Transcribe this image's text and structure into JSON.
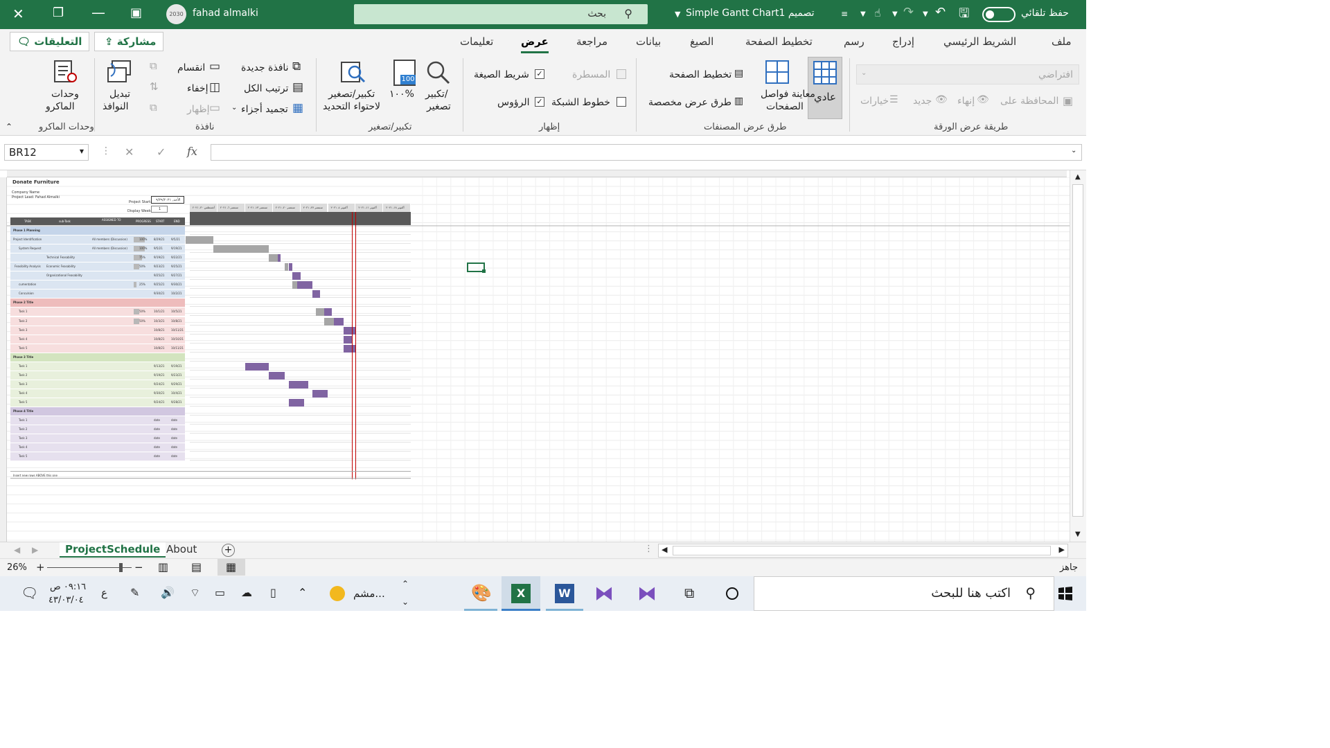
{
  "titlebar": {
    "user_name": "fahad almalki",
    "avatar_text": "2030",
    "search_placeholder": "بحث",
    "file_title": "Simple Gantt Chart1 تصميم",
    "autosave_label": "حفظ تلقائي",
    "autosave_state": "off"
  },
  "menu": {
    "items": [
      "ملف",
      "الشريط الرئيسي",
      "إدراج",
      "رسم",
      "تخطيط الصفحة",
      "الصيغ",
      "بيانات",
      "مراجعة",
      "عرض",
      "تعليمات"
    ],
    "active": "عرض",
    "share_label": "مشاركة",
    "comments_label": "التعليقات"
  },
  "ribbon": {
    "sheet_view": {
      "dropdown": "افتراضي",
      "keep": "المحافظة على",
      "exit": "إنهاء",
      "new": "جديد",
      "options": "خيارات",
      "group": "طريقة عرض الورقة"
    },
    "workbook_views": {
      "normal": "عادي",
      "page_break_1": "معاينة فواصل",
      "page_break_2": "الصفحات",
      "page_layout": "تخطيط الصفحة",
      "custom": "طرق عرض مخصصة",
      "group": "طرق عرض المصنفات"
    },
    "show": {
      "ruler": "المسطرة",
      "formula_bar": "شريط الصيغة",
      "gridlines": "خطوط الشبكة",
      "headings": "الرؤوس",
      "group": "إظهار",
      "ruler_checked": false,
      "formula_bar_checked": true,
      "gridlines_checked": false,
      "headings_checked": true
    },
    "zoom": {
      "zoom_1": "تكبير/",
      "zoom_2": "تصغير",
      "hundred": "١٠٠%",
      "hundred_icon": "100",
      "to_sel_1": "تكبير/تصغير",
      "to_sel_2": "لاحتواء التحديد",
      "group": "تكبير/تصغير"
    },
    "window": {
      "new_window": "نافذة جديدة",
      "arrange": "ترتيب الكل",
      "freeze": "تجميد أجزاء",
      "split": "انقسام",
      "hide": "إخفاء",
      "unhide": "إظهار",
      "switch_1": "تبديل",
      "switch_2": "النوافذ",
      "group": "نافذة"
    },
    "macros": {
      "label_1": "وحدات",
      "label_2": "الماكرو",
      "group": "وحدات الماكرو"
    }
  },
  "formula_bar": {
    "name_box": "BR12",
    "fx": "fx",
    "value": ""
  },
  "sheet": {
    "title": "Donate Furniture",
    "company": "Company Name",
    "lead": "Project Lead: Fahad Almalki",
    "project_start_label": "Project Start:",
    "project_start_value": "الأحد, ٩/٢٩/٢٠٢١",
    "display_week_label": "Display Week:",
    "display_week_value": "1",
    "week_headers": [
      "أغسطس ٣٠، ٢٠٢١",
      "سبتمبر ٦، ٢٠٢١",
      "سبتمبر ١٣، ٢٠٢١",
      "سبتمبر ٢٠، ٢٠٢١",
      "سبتمبر ٢٧، ٢٠٢١",
      "أكتوبر ٤، ٢٠٢١",
      "أكتوبر ١١، ٢٠٢١",
      "أكتوبر ١٨، ٢٠٢١"
    ],
    "col_headers": [
      "TASK",
      "sub-Task",
      "ASSIGNED TO",
      "PROGRESS",
      "START",
      "END"
    ],
    "footer": "Insert new rows ABOVE this one",
    "rows": [
      {
        "task": "Phase 1 Planning",
        "sub": "",
        "assigned": "",
        "progress": "",
        "start": "",
        "end": "",
        "phase": 1,
        "header": true
      },
      {
        "task": "Project Identification",
        "sub": "",
        "assigned": "All members (Discussion)",
        "progress": "100%",
        "start": "8/29/21",
        "end": "9/5/21",
        "phase": 1
      },
      {
        "task": "System Request",
        "sub": "",
        "assigned": "All members (Discussion)",
        "progress": "100%",
        "start": "9/5/21",
        "end": "9/19/21",
        "phase": 1
      },
      {
        "task": "",
        "sub": "Technical Feasability",
        "assigned": "",
        "progress": "75%",
        "start": "9/19/21",
        "end": "9/22/21",
        "phase": 1
      },
      {
        "task": "Feasibility Analysis",
        "sub": "Economic Feasability",
        "assigned": "",
        "progress": "50%",
        "start": "9/23/21",
        "end": "9/25/21",
        "phase": 1
      },
      {
        "task": "",
        "sub": "Organizational Feasability",
        "assigned": "",
        "progress": "",
        "start": "9/25/21",
        "end": "9/27/21",
        "phase": 1
      },
      {
        "task": "cumentation",
        "sub": "",
        "assigned": "",
        "progress": "25%",
        "start": "9/25/21",
        "end": "9/30/21",
        "phase": 1
      },
      {
        "task": "Conculsion",
        "sub": "",
        "assigned": "",
        "progress": "",
        "start": "9/30/21",
        "end": "10/2/21",
        "phase": 1
      },
      {
        "task": "Phase 2 Title",
        "sub": "",
        "assigned": "",
        "progress": "",
        "start": "",
        "end": "",
        "phase": 2,
        "header": true
      },
      {
        "task": "Task 1",
        "sub": "",
        "assigned": "",
        "progress": "50%",
        "start": "10/1/21",
        "end": "10/5/21",
        "phase": 2
      },
      {
        "task": "Task 2",
        "sub": "",
        "assigned": "",
        "progress": "50%",
        "start": "10/3/21",
        "end": "10/8/21",
        "phase": 2
      },
      {
        "task": "Task 3",
        "sub": "",
        "assigned": "",
        "progress": "",
        "start": "10/8/21",
        "end": "10/11/21",
        "phase": 2
      },
      {
        "task": "Task 4",
        "sub": "",
        "assigned": "",
        "progress": "",
        "start": "10/8/21",
        "end": "10/10/21",
        "phase": 2
      },
      {
        "task": "Task 5",
        "sub": "",
        "assigned": "",
        "progress": "",
        "start": "10/8/21",
        "end": "10/11/21",
        "phase": 2
      },
      {
        "task": "Phase 3 Title",
        "sub": "",
        "assigned": "",
        "progress": "",
        "start": "",
        "end": "",
        "phase": 3,
        "header": true
      },
      {
        "task": "Task 1",
        "sub": "",
        "assigned": "",
        "progress": "",
        "start": "9/13/21",
        "end": "9/19/21",
        "phase": 3
      },
      {
        "task": "Task 2",
        "sub": "",
        "assigned": "",
        "progress": "",
        "start": "9/19/21",
        "end": "9/23/21",
        "phase": 3
      },
      {
        "task": "Task 3",
        "sub": "",
        "assigned": "",
        "progress": "",
        "start": "9/24/21",
        "end": "9/29/21",
        "phase": 3
      },
      {
        "task": "Task 4",
        "sub": "",
        "assigned": "",
        "progress": "",
        "start": "9/30/21",
        "end": "10/4/21",
        "phase": 3
      },
      {
        "task": "Task 5",
        "sub": "",
        "assigned": "",
        "progress": "",
        "start": "9/24/21",
        "end": "9/28/21",
        "phase": 3
      },
      {
        "task": "Phase 4 Title",
        "sub": "",
        "assigned": "",
        "progress": "",
        "start": "",
        "end": "",
        "phase": 4,
        "header": true
      },
      {
        "task": "Task 1",
        "sub": "",
        "assigned": "",
        "progress": "",
        "start": "date",
        "end": "date",
        "phase": 4
      },
      {
        "task": "Task 2",
        "sub": "",
        "assigned": "",
        "progress": "",
        "start": "date",
        "end": "date",
        "phase": 4
      },
      {
        "task": "Task 3",
        "sub": "",
        "assigned": "",
        "progress": "",
        "start": "date",
        "end": "date",
        "phase": 4
      },
      {
        "task": "Task 4",
        "sub": "",
        "assigned": "",
        "progress": "",
        "start": "date",
        "end": "date",
        "phase": 4
      },
      {
        "task": "Task 5",
        "sub": "",
        "assigned": "",
        "progress": "",
        "start": "date",
        "end": "date",
        "phase": 4
      }
    ],
    "colors": {
      "phase1": "#dbe5f1",
      "phase1_head": "#c5d5ea",
      "phase2": "#f7dede",
      "phase2_head": "#eebcbc",
      "phase3": "#e8f0dc",
      "phase3_head": "#d3e4bf",
      "phase4": "#e6e0ee",
      "phase4_head": "#d1c7e0",
      "bar": "#8064a2",
      "bar_done": "#a6a6a6",
      "today_line": "#c00000",
      "header_dark": "#595959"
    }
  },
  "tabs": {
    "items": [
      "ProjectSchedule",
      "About"
    ],
    "active": "ProjectSchedule"
  },
  "status": {
    "ready": "جاهز",
    "zoom": "26%"
  },
  "taskbar": {
    "search_placeholder": "اكتب هنا للبحث",
    "time": "٠٩:١٦ ص",
    "date": "٤٣/٠٣/٠٤",
    "lang": "ع",
    "weather_label": "مشم..."
  }
}
